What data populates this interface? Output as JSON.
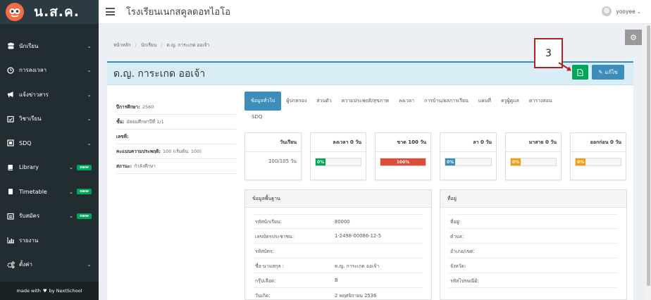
{
  "logo": {
    "text": "น.ส.ค."
  },
  "sidebar": {
    "items": [
      {
        "label": "นักเรียน",
        "icon": "users-icon",
        "chevron": "⌄",
        "badge": ""
      },
      {
        "label": "การลงเวลา",
        "icon": "clock-icon",
        "chevron": "⌄",
        "badge": ""
      },
      {
        "label": "แจ้งข่าวสาร",
        "icon": "megaphone-icon",
        "chevron": "⌄",
        "badge": ""
      },
      {
        "label": "วิชาเรียน",
        "icon": "calendar-check-icon",
        "chevron": "⌄",
        "badge": ""
      },
      {
        "label": "SDQ",
        "icon": "sdq-icon",
        "chevron": "⌄",
        "badge": ""
      },
      {
        "label": "Library",
        "icon": "book-icon",
        "chevron": "⌄",
        "badge": "new"
      },
      {
        "label": "Timetable",
        "icon": "timetable-icon",
        "chevron": "⌄",
        "badge": "new"
      },
      {
        "label": "รับสมัคร",
        "icon": "apply-icon",
        "chevron": "⌄",
        "badge": "new"
      },
      {
        "label": "รายงาน",
        "icon": "bar-chart-icon",
        "chevron": "",
        "badge": ""
      },
      {
        "label": "ตั้งค่า",
        "icon": "cogs-icon",
        "chevron": "⌄",
        "badge": ""
      }
    ],
    "footer": {
      "prefix": "made with",
      "suffix": "by NextSchool"
    }
  },
  "header": {
    "school_name": "โรงเรียนเนกสคูลดอทไอโอ",
    "user_name": "yooyee",
    "user_chevron": "⌄"
  },
  "breadcrumb": {
    "home": "หน้าหลัก",
    "students": "นักเรียน",
    "current": "ด.ญ. การะเกด ออเจ้า",
    "sep": "/"
  },
  "student": {
    "name": "ด.ญ. การะเกด ออเจ้า"
  },
  "buttons": {
    "edit_label": "แก้ไข"
  },
  "callout": {
    "number": "3"
  },
  "info": [
    {
      "key": "ปีการศึกษา:",
      "value": "2560"
    },
    {
      "key": "ชั้น:",
      "value": "มัธยมศึกษาปีที่ 1/1"
    },
    {
      "key": "เลขที่:",
      "value": ""
    },
    {
      "key": "คะแนนความประพฤติ:",
      "value": "100 (เริ่มต้น: 100)"
    },
    {
      "key": "สถานะ:",
      "value": "กำลังศึกษา"
    }
  ],
  "tabs": [
    "ข้อมูลทั่วไป",
    "ผู้ปกครอง",
    "ส่วนตัว",
    "ความประพฤติ/สุขภาพ",
    "ลงเวลา",
    "การบ้าน/ผลการเรียน",
    "แผนที่",
    "ครูผู้ดูแล",
    "ตารางสอน"
  ],
  "tab_sdq": "SDQ",
  "stats": [
    {
      "title": "วันเรียน",
      "text": "100/105 วัน",
      "percent": null,
      "color": ""
    },
    {
      "title": "ลงเวลา 0 วัน",
      "label": "0%",
      "percent": 0,
      "color": "#00a65a"
    },
    {
      "title": "ขาด 100 วัน",
      "label": "100%",
      "percent": 100,
      "color": "#dd4b39"
    },
    {
      "title": "ลา 0 วัน",
      "label": "0%",
      "percent": 0,
      "color": "#3c8dbc"
    },
    {
      "title": "มาสาย 0 วัน",
      "label": "0%",
      "percent": 0,
      "color": "#f39c12"
    },
    {
      "title": "ออกก่อน 0 วัน",
      "label": "0%",
      "percent": 0,
      "color": "#f39c12"
    }
  ],
  "basic_panel": {
    "title": "ข้อมูลพื้นฐาน",
    "rows": [
      {
        "key": "รหัสนักเรียน:",
        "value": "80000"
      },
      {
        "key": "เลขบัตรประชาชน:",
        "value": "1-2498-00086-12-5"
      },
      {
        "key": "รหัสบัตร:",
        "value": ""
      },
      {
        "key": "ชื่อ-นามสกุล :",
        "value": "ด.ญ. การะเกด ออเจ้า"
      },
      {
        "key": "กรุ๊ปเลือด:",
        "value": "B"
      },
      {
        "key": "วันเกิด:",
        "value": "2 พฤศจิกายน 2536"
      }
    ]
  },
  "address_panel": {
    "title": "ที่อยู่",
    "rows": [
      {
        "key": "ที่อยู่:",
        "value": ""
      },
      {
        "key": "ตำบล:",
        "value": ""
      },
      {
        "key": "อำเภอ/เขต:",
        "value": ""
      },
      {
        "key": "จังหวัด:",
        "value": ""
      },
      {
        "key": "รหัสไปรษณีย์:",
        "value": ""
      }
    ]
  }
}
